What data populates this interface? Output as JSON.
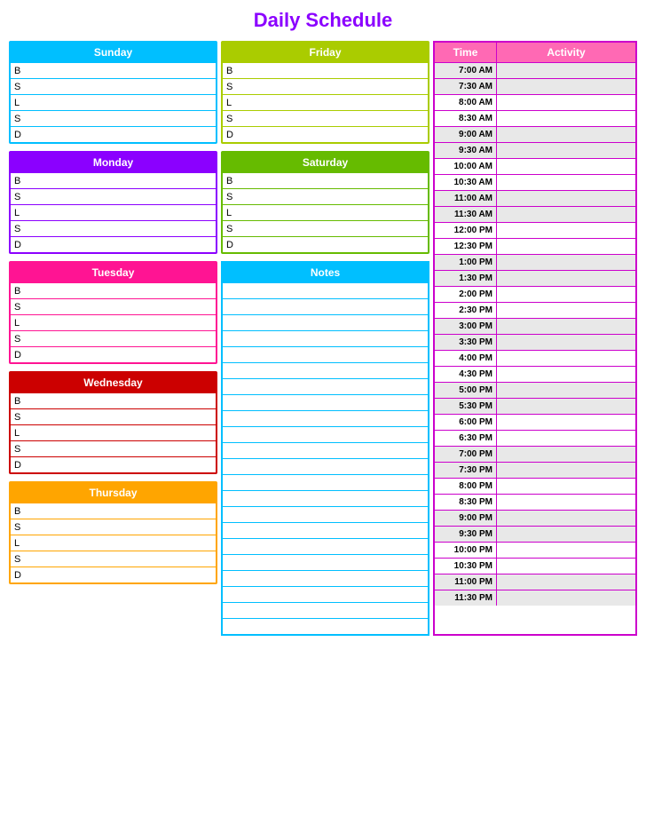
{
  "title": "Daily Schedule",
  "days": {
    "sunday": {
      "label": "Sunday",
      "rows": [
        "B",
        "S",
        "L",
        "S",
        "D"
      ]
    },
    "monday": {
      "label": "Monday",
      "rows": [
        "B",
        "S",
        "L",
        "S",
        "D"
      ]
    },
    "tuesday": {
      "label": "Tuesday",
      "rows": [
        "B",
        "S",
        "L",
        "S",
        "D"
      ]
    },
    "wednesday": {
      "label": "Wednesday",
      "rows": [
        "B",
        "S",
        "L",
        "S",
        "D"
      ]
    },
    "thursday": {
      "label": "Thursday",
      "rows": [
        "B",
        "S",
        "L",
        "S",
        "D"
      ]
    },
    "friday": {
      "label": "Friday",
      "rows": [
        "B",
        "S",
        "L",
        "S",
        "D"
      ]
    },
    "saturday": {
      "label": "Saturday",
      "rows": [
        "B",
        "S",
        "L",
        "S",
        "D"
      ]
    }
  },
  "notes": {
    "label": "Notes",
    "row_count": 22
  },
  "schedule": {
    "time_label": "Time",
    "activity_label": "Activity",
    "times": [
      "7:00 AM",
      "7:30 AM",
      "8:00 AM",
      "8:30 AM",
      "9:00 AM",
      "9:30 AM",
      "10:00 AM",
      "10:30 AM",
      "11:00 AM",
      "11:30 AM",
      "12:00 PM",
      "12:30 PM",
      "1:00 PM",
      "1:30 PM",
      "2:00 PM",
      "2:30 PM",
      "3:00 PM",
      "3:30 PM",
      "4:00 PM",
      "4:30 PM",
      "5:00 PM",
      "5:30 PM",
      "6:00 PM",
      "6:30 PM",
      "7:00 PM",
      "7:30 PM",
      "8:00 PM",
      "8:30 PM",
      "9:00 PM",
      "9:30 PM",
      "10:00 PM",
      "10:30 PM",
      "11:00 PM",
      "11:30 PM"
    ]
  }
}
